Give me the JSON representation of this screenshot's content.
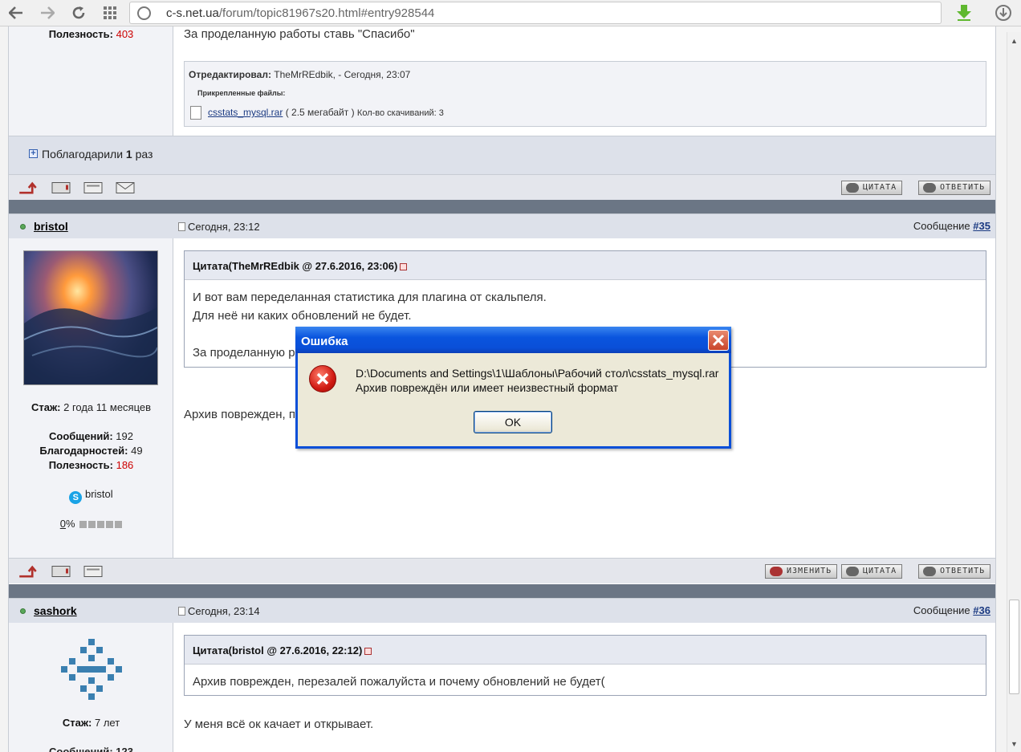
{
  "browser": {
    "url_host": "c-s.net.ua",
    "url_path": "/forum/topic81967s20.html#entry928544"
  },
  "prev_post": {
    "usefulness_label": "Полезность:",
    "usefulness_value": "403",
    "text_tail": "За проделанную работы ставь \"Спасибо\"",
    "edited_label": "Отредактировал:",
    "edited_value": "TheMrREdbik, - Сегодня, 23:07",
    "attached_label": "Прикрепленные файлы:",
    "file_name": "csstats_mysql.rar",
    "file_size": "( 2.5 мегабайт )",
    "downloads": "Кол-во скачиваний: 3",
    "thanks_prefix": "Поблагодарили",
    "thanks_count": "1",
    "thanks_suffix": "раз",
    "btn_quote": "ЦИТАТА",
    "btn_reply": "ОТВЕТИТЬ"
  },
  "post35": {
    "author": "bristol",
    "date": "Сегодня, 23:12",
    "msg_label": "Сообщение",
    "msg_num": "#35",
    "quote_head": "Цитата(TheMrREdbik @ 27.6.2016, 23:06)",
    "quote_line1": "И вот вам переделанная статистика для плагина от скальпеля.",
    "quote_line2": "Для неё ни каких обновлений не будет.",
    "quote_line3": "За проделанную р",
    "reply": "Архив поврежден, п",
    "stage_label": "Стаж:",
    "stage_value": "2 года 11 месяцев",
    "messages_label": "Сообщений:",
    "messages_value": "192",
    "thanks_label": "Благодарностей:",
    "thanks_value": "49",
    "useful_label": "Полезность:",
    "useful_value": "186",
    "skype": "bristol",
    "rating": "0",
    "rating_pct": "%",
    "btn_edit": "ИЗМЕНИТЬ",
    "btn_quote": "ЦИТАТА",
    "btn_reply": "ОТВЕТИТЬ"
  },
  "post36": {
    "author": "sashork",
    "date": "Сегодня, 23:14",
    "msg_label": "Сообщение",
    "msg_num": "#36",
    "quote_head": "Цитата(bristol @ 27.6.2016, 22:12)",
    "quote_line1": "Архив поврежден, перезалей пожалуйста и почему обновлений не будет(",
    "reply": "У меня всё ок качает и открывает.",
    "stage_label": "Стаж:",
    "stage_value": "7 лет",
    "messages_partial": "Сообщений: 123"
  },
  "dialog": {
    "title": "Ошибка",
    "path": "D:\\Documents and Settings\\1\\Шаблоны\\Рабочий стол\\csstats_mysql.rar",
    "message": "Архив повреждён или имеет неизвестный формат",
    "ok": "OK"
  },
  "colors": {
    "accent_red": "#cc0000",
    "link_blue": "#1b3a82",
    "xp_blue": "#0a4fd8"
  }
}
